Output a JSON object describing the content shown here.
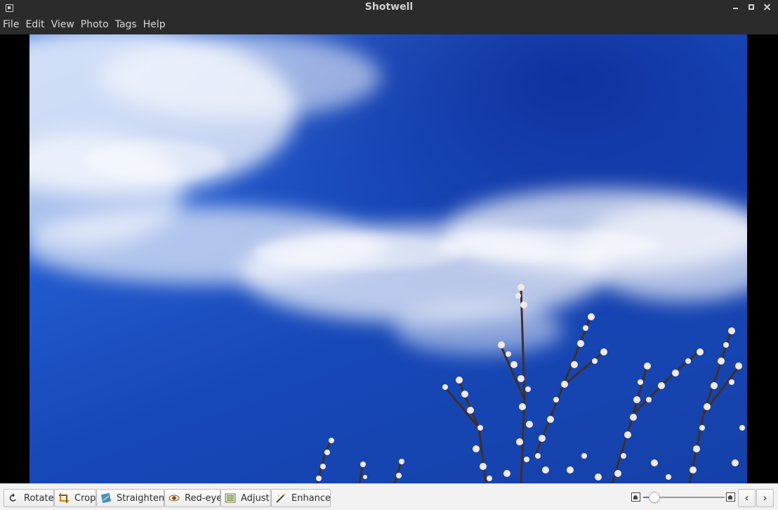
{
  "window": {
    "title": "Shotwell"
  },
  "menu": [
    "File",
    "Edit",
    "View",
    "Photo",
    "Tags",
    "Help"
  ],
  "toolbar": {
    "tools": [
      {
        "id": "rotate",
        "label": "Rotate",
        "icon": "rotate-icon"
      },
      {
        "id": "crop",
        "label": "Crop",
        "icon": "crop-icon"
      },
      {
        "id": "straighten",
        "label": "Straighten",
        "icon": "straighten-icon"
      },
      {
        "id": "redeye",
        "label": "Red-eye",
        "icon": "red-eye-icon"
      },
      {
        "id": "adjust",
        "label": "Adjust",
        "icon": "adjust-icon"
      },
      {
        "id": "enhance",
        "label": "Enhance",
        "icon": "enhance-icon"
      }
    ],
    "zoom_level": 0.08,
    "prev_glyph": "‹",
    "next_glyph": "›"
  },
  "colors": {
    "accent": "#3b7ad9",
    "chrome_dark": "#2b2b2b",
    "toolbar_bg": "#f2f2f2",
    "sky": "#1d50c4"
  }
}
